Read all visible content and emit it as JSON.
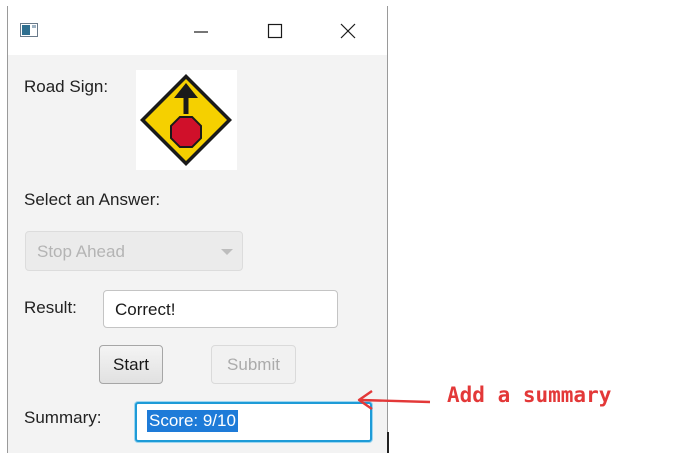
{
  "window": {
    "title": "",
    "icons": {
      "app": "app-icon",
      "minimize": "minimize-icon",
      "maximize": "maximize-icon",
      "close": "close-icon"
    }
  },
  "form": {
    "road_sign_label": "Road Sign:",
    "road_sign_image": "stop-ahead-sign",
    "select_label": "Select an Answer:",
    "dropdown": {
      "selected": "Stop Ahead",
      "icon": "chevron-down-icon",
      "disabled": true
    },
    "result_label": "Result:",
    "result_value": "Correct!",
    "buttons": {
      "start": "Start",
      "submit": "Submit"
    },
    "summary_label": "Summary:",
    "summary_value": "Score: 9/10"
  },
  "annotation": {
    "text": "Add a summary",
    "color": "#e33838"
  },
  "colors": {
    "accent": "#1e9bd7",
    "selection": "#1e7bd8",
    "sign_yellow": "#f5d000",
    "sign_red": "#d0102a"
  }
}
